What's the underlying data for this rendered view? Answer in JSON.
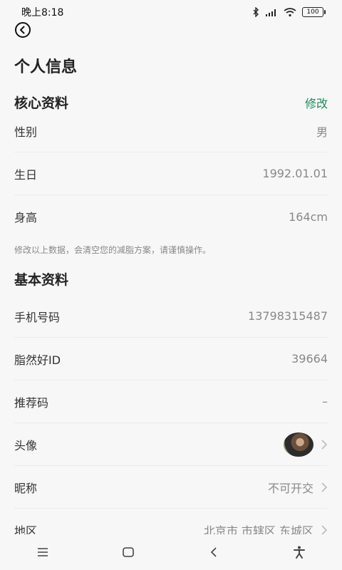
{
  "status": {
    "time": "晚上8:18",
    "battery": "100"
  },
  "page": {
    "title": "个人信息"
  },
  "core": {
    "title": "核心资料",
    "edit_label": "修改",
    "rows": [
      {
        "label": "性别",
        "value": "男"
      },
      {
        "label": "生日",
        "value": "1992.01.01"
      },
      {
        "label": "身高",
        "value": "164cm"
      }
    ],
    "note": "修改以上数据，会清空您的减脂方案，请谨慎操作。"
  },
  "basic": {
    "title": "基本资料",
    "rows": [
      {
        "label": "手机号码",
        "value": "13798315487"
      },
      {
        "label": "脂然好ID",
        "value": "39664"
      },
      {
        "label": "推荐码",
        "value": "–"
      },
      {
        "label": "头像",
        "value": ""
      },
      {
        "label": "昵称",
        "value": "不可开交"
      },
      {
        "label": "地区",
        "value": "北京市 市辖区 东城区"
      }
    ]
  },
  "icons": {
    "back": "back-arrow-icon",
    "bluetooth": "bluetooth-icon",
    "signal": "signal-icon",
    "wifi": "wifi-icon",
    "battery": "battery-icon",
    "chevron": "chevron-right-icon",
    "nav_menu": "menu-icon",
    "nav_home": "home-icon",
    "nav_back": "back-icon",
    "nav_accessibility": "accessibility-icon"
  },
  "colors": {
    "accent": "#1f8a5b",
    "background": "#f7f7f7"
  }
}
